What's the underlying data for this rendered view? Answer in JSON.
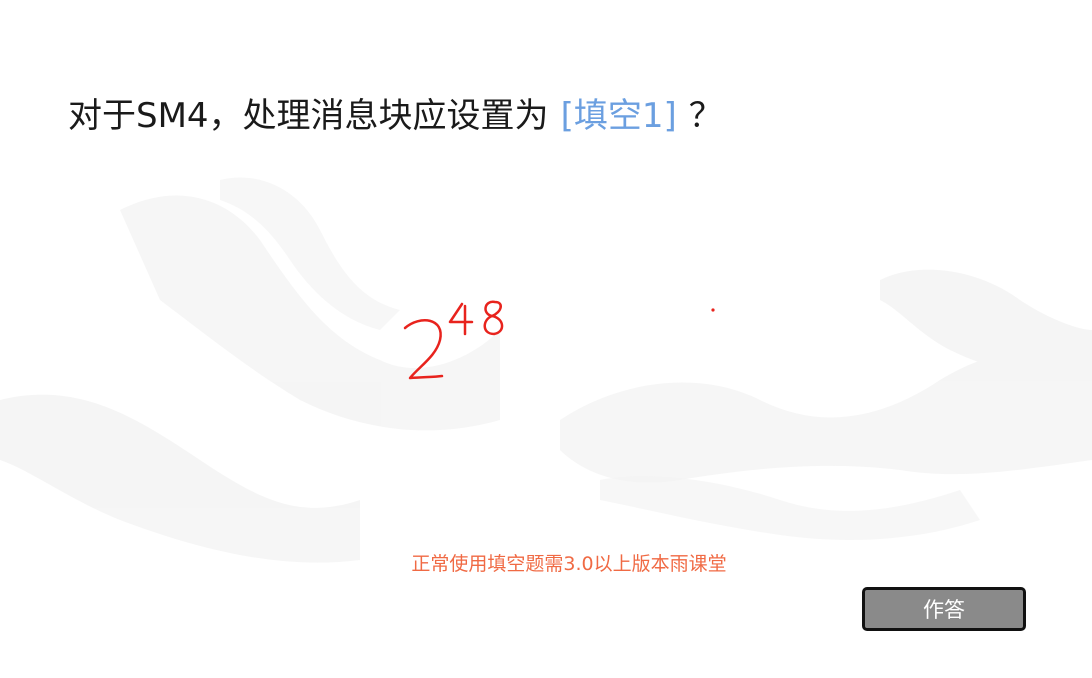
{
  "question": {
    "text": "对于SM4，处理消息块应设置为",
    "blank_label": "[填空1]",
    "suffix": "？"
  },
  "annotation": {
    "base": "2",
    "exponent": "48",
    "ink_color": "#e8231d"
  },
  "hint": {
    "text": "正常使用填空题需3.0以上版本雨课堂",
    "color": "#f06a44"
  },
  "answer_button": {
    "label": "作答"
  },
  "colors": {
    "blank": "#6b9fe0",
    "button_bg": "#8a8a8a",
    "button_border": "#111111",
    "question_text": "#1a1a1a"
  }
}
